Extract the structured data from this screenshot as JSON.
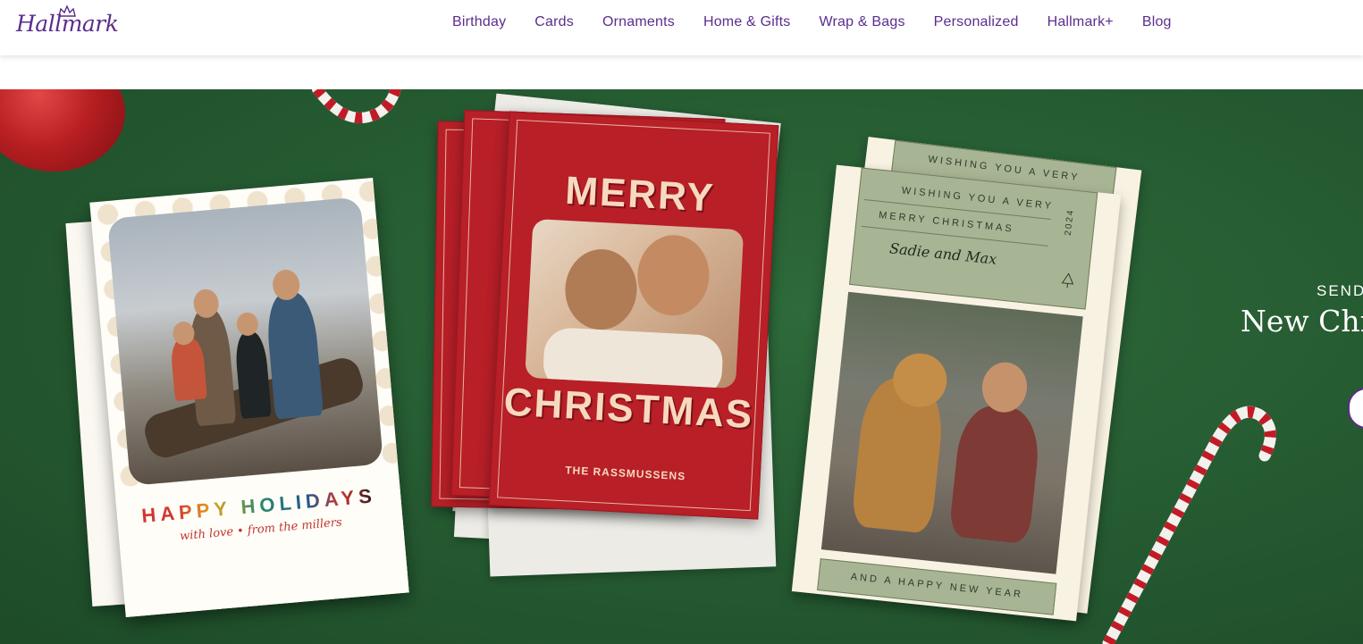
{
  "header": {
    "logo_text": "Hallmark",
    "nav": [
      "Birthday",
      "Cards",
      "Ornaments",
      "Home & Gifts",
      "Wrap & Bags",
      "Personalized",
      "Hallmark+",
      "Blog"
    ]
  },
  "hero": {
    "eyebrow": "SEND",
    "title": "New Chri",
    "card_holidays": {
      "title": "HAPPY HOLIDAYS",
      "subtitle": "with love • from the millers"
    },
    "card_merry": {
      "line1": "MERRY",
      "line2": "CHRISTMAS",
      "footer": "THE RASSMUSSENS"
    },
    "card_sadie": {
      "line1": "WISHING YOU A VERY",
      "line2": "MERRY CHRISTMAS",
      "names": "Sadie and Max",
      "year": "2024",
      "footer": "AND A HAPPY NEW YEAR",
      "back_line1": "WISHING YOU A VERY",
      "back_year": "24"
    }
  },
  "colors": {
    "brand": "#5b2d8e",
    "hero_bg": "#255a31",
    "card_red": "#b81f27",
    "sage": "#a8b594"
  }
}
